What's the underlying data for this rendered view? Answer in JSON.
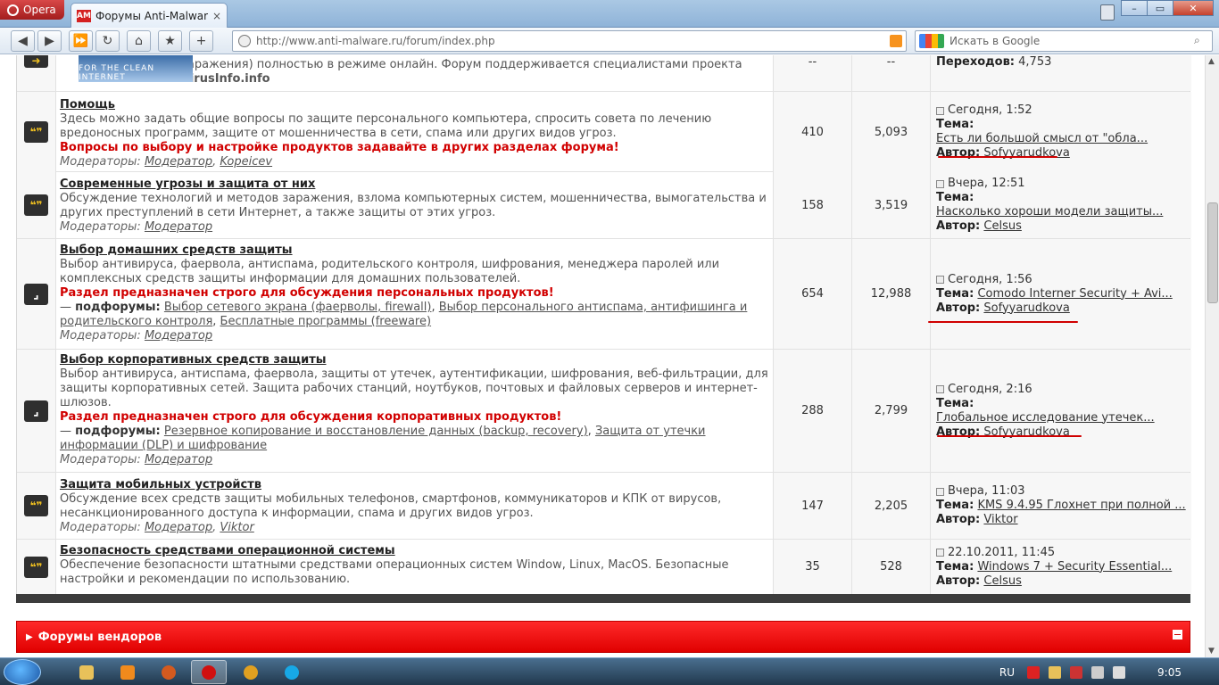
{
  "browser": {
    "menu_label": "Opera",
    "tab_title": "Форумы Anti-Malware...",
    "tab_favicon_text": "AM",
    "tab_close": "×",
    "window_controls": [
      "–",
      "▭",
      "✕"
    ],
    "address_url": "http://www.anti-malware.ru/forum/index.php",
    "search_placeholder": "Искать в Google",
    "toolbar_icons": [
      "back-icon",
      "forward-icon",
      "fast-forward-icon",
      "reload-icon",
      "home-icon",
      "bookmarks-icon",
      "new-tab-icon"
    ]
  },
  "top_partial": {
    "desc_tail": "заражения) полностью в режиме онлайн. Форум поддерживается специалистами проекта",
    "desc_source": "VirusInfo.info",
    "topics": "--",
    "posts": "--",
    "transitions_label": "Переходов:",
    "transitions_value": "4,753",
    "logo_text": "FOR THE CLEAN INTERNET"
  },
  "forums": [
    {
      "title": "Помощь",
      "desc": "Здесь можно задать общие вопросы по защите персонального компьютера, спросить совета по лечению вредоносных программ, защите от мошенничества в сети, спама или других видов угроз.",
      "warn": "Вопросы по выбору и настройке продуктов задавайте в других разделах форума!",
      "mod_label": "Модераторы:",
      "mods": [
        "Модератор",
        "Kopeicev"
      ],
      "topics": "410",
      "posts": "5,093",
      "last_date": "Сегодня, 1:52",
      "last_topic": "Есть ли большой смысл от \"обла...",
      "last_author": "Sofyyarudkova"
    },
    {
      "title": "Современные угрозы и защита от них",
      "desc": "Обсуждение технологий и методов заражения, взлома компьютерных систем, мошенничества, вымогательства и других преступлений в сети Интернет, а также защиты от этих угроз.",
      "mod_label": "Модераторы:",
      "mods": [
        "Модератор"
      ],
      "topics": "158",
      "posts": "3,519",
      "last_date": "Вчера, 12:51",
      "last_topic": "Насколько хороши модели защиты...",
      "last_author": "Celsus"
    },
    {
      "title": "Выбор домашних средств защиты",
      "desc": "Выбор антивируса, фаервола, антиспама, родительского контроля, шифрования, менеджера паролей или комплексных средств защиты информации для домашних пользователей.",
      "warn": "Раздел предназначен строго для обсуждения персональных продуктов!",
      "sub_label": "подфорумы:",
      "subs": [
        "Выбор сетевого экрана (фаерволы, firewall)",
        "Выбор персонального антиспама, антифишинга и родительского контроля",
        "Бесплатные программы (freeware)"
      ],
      "mod_label": "Модераторы:",
      "mods": [
        "Модератор"
      ],
      "topics": "654",
      "posts": "12,988",
      "last_date": "Сегодня, 1:56",
      "last_topic": "Comodo Interner Security + Avi...",
      "last_author": "Sofyyarudkova"
    },
    {
      "title": "Выбор корпоративных средств защиты",
      "desc": "Выбор антивируса, антиспама, фаервола, защиты от утечек, аутентификации, шифрования, веб-фильтрации, для защиты корпоративных сетей. Защита рабочих станций, ноутбуков, почтовых и файловых серверов и интернет-шлюзов.",
      "warn": "Раздел предназначен строго для обсуждения корпоративных продуктов!",
      "sub_label": "подфорумы:",
      "subs": [
        "Резервное копирование и восстановление данных (backup, recovery)",
        "Защита от утечки информации (DLP) и шифрование"
      ],
      "mod_label": "Модераторы:",
      "mods": [
        "Модератор"
      ],
      "topics": "288",
      "posts": "2,799",
      "last_date": "Сегодня, 2:16",
      "last_topic": "Глобальное исследование утечек...",
      "last_author": "Sofyyarudkova"
    },
    {
      "title": "Защита мобильных устройств",
      "desc": "Обсуждение всех средств защиты мобильных телефонов, смартфонов, коммуникаторов и КПК от вирусов, несанкционированного доступа к информации, спама и других видов угроз.",
      "mod_label": "Модераторы:",
      "mods": [
        "Модератор",
        "Viktor"
      ],
      "topics": "147",
      "posts": "2,205",
      "last_date": "Вчера, 11:03",
      "last_topic": "KMS 9.4.95 Глохнет при полной ...",
      "last_author": "Viktor"
    },
    {
      "title": "Безопасность средствами операционной системы",
      "desc": "Обеспечение безопасности штатными средствами операционных систем Window, Linux, MacOS. Безопасные настройки и рекомендации по использованию.",
      "topics": "35",
      "posts": "528",
      "last_date": "22.10.2011, 11:45",
      "last_topic": "Windows 7 + Security Essential...",
      "last_author": "Celsus"
    }
  ],
  "last_labels": {
    "topic": "Тема:",
    "author": "Автор:"
  },
  "sub_prefix": "—",
  "vendors_section": {
    "title": "Форумы вендоров"
  },
  "taskbar": {
    "apps": [
      "explorer-icon",
      "media-player-icon",
      "firefox-icon",
      "opera-icon",
      "app-icon",
      "skype-icon"
    ],
    "lang": "RU",
    "clock": "9:05"
  },
  "colors": {
    "accent_red": "#e00000",
    "warn_red": "#d10000",
    "highlight_line": "#d00000"
  }
}
